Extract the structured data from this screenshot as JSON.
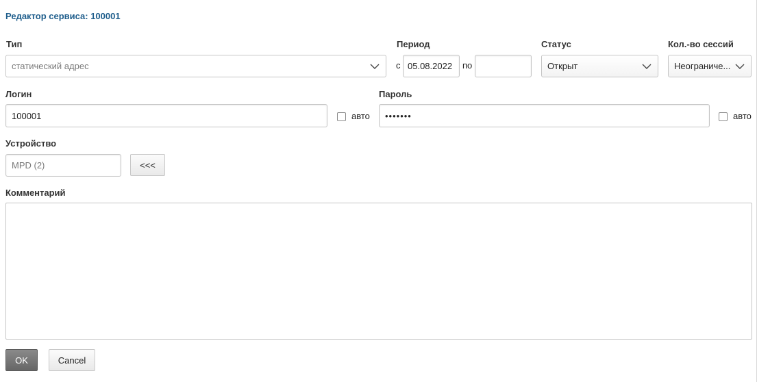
{
  "dialog": {
    "title": "Редактор сервиса: 100001"
  },
  "type": {
    "label": "Тип",
    "value": "статический адрес"
  },
  "period": {
    "label": "Период",
    "from_prefix": "с",
    "from_value": "05.08.2022",
    "to_prefix": "по",
    "to_value": ""
  },
  "status": {
    "label": "Статус",
    "value": "Открыт"
  },
  "sessions": {
    "label": "Кол.-во сессий",
    "value": "Неограниче..."
  },
  "login": {
    "label": "Логин",
    "value": "100001",
    "auto_label": "авто",
    "auto_checked": false
  },
  "password": {
    "label": "Пароль",
    "value": "•••••••",
    "auto_label": "авто",
    "auto_checked": false
  },
  "device": {
    "label": "Устройство",
    "value": "MPD (2)",
    "pick_button": "<<<"
  },
  "comment": {
    "label": "Комментарий",
    "value": ""
  },
  "actions": {
    "ok": "OK",
    "cancel": "Cancel"
  },
  "colors": {
    "title": "#1f5e8c",
    "primary_button": "#777777"
  }
}
